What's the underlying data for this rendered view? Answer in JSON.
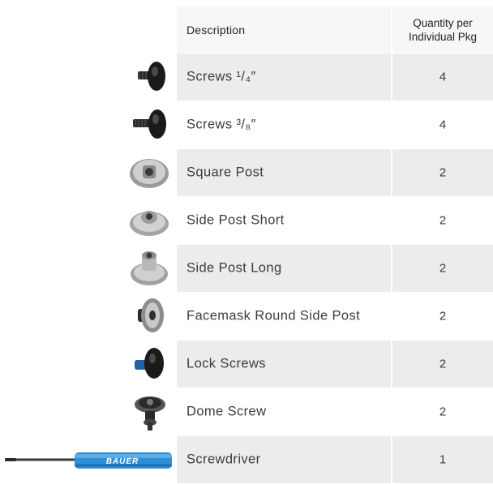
{
  "header": {
    "description": "Description",
    "quantity_line1": "Quantity per",
    "quantity_line2": "Individual Pkg"
  },
  "rows": [
    {
      "name_prefix": "Screws ",
      "fraction": "¹/₄″",
      "name": "",
      "qty": "4",
      "icon": "screw-icon"
    },
    {
      "name_prefix": "Screws ",
      "fraction": "³/₈″",
      "name": "",
      "qty": "4",
      "icon": "screw-icon"
    },
    {
      "name": "Square Post",
      "qty": "2",
      "icon": "square-post-icon"
    },
    {
      "name": "Side Post Short",
      "qty": "2",
      "icon": "side-post-short-icon"
    },
    {
      "name": "Side Post Long",
      "qty": "2",
      "icon": "side-post-long-icon"
    },
    {
      "name": "Facemask Round Side Post",
      "qty": "2",
      "icon": "facemask-round-side-post-icon"
    },
    {
      "name": "Lock Screws",
      "qty": "2",
      "icon": "lock-screw-icon"
    },
    {
      "name": "Dome Screw",
      "qty": "2",
      "icon": "dome-screw-icon"
    },
    {
      "name": "Screwdriver",
      "qty": "1",
      "icon": "screwdriver-icon"
    }
  ],
  "screwdriver_brand": "BAUER",
  "colors": {
    "band_odd": "#ececec",
    "band_even": "#ffffff",
    "text": "#3c3c3c",
    "screwdriver_blue": "#2f8fd6"
  }
}
